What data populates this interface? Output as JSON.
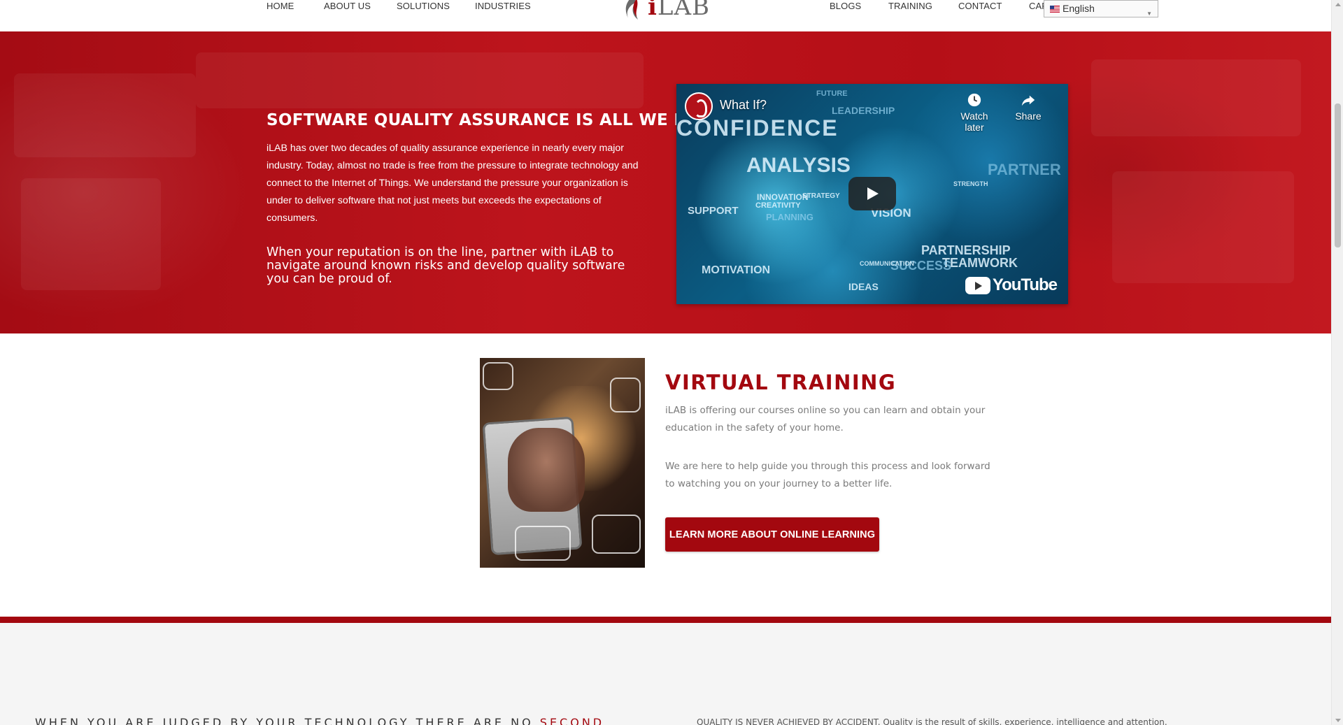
{
  "nav": {
    "left_items": [
      "HOME",
      "ABOUT US",
      "SOLUTIONS",
      "INDUSTRIES"
    ],
    "right_items": [
      "BLOGS",
      "TRAINING",
      "CONTACT",
      "CAR"
    ],
    "logo_text": "iLAB",
    "language": {
      "selected": "English",
      "flag_icon": "us-flag-icon"
    }
  },
  "hero": {
    "title": "SOFTWARE QUALITY ASSURANCE IS ALL WE DO.",
    "body": "iLAB has over two decades of quality assurance experience in nearly every major industry. Today, almost no trade is free from the pressure to integrate technology and connect to the Internet of Things. We understand the pressure your organization is under to deliver software that not just meets but exceeds the expectations of consumers.",
    "subtext": "When your reputation is on the line, partner with iLAB to navigate around known risks and develop quality software you can be proud of.",
    "colors": {
      "hero_red": "#b60f18",
      "brand_red": "#a3080f"
    }
  },
  "video": {
    "title": "What If?",
    "watch_later": "Watch later",
    "share": "Share",
    "youtube": "YouTube",
    "words": [
      "CONFIDENCE",
      "ANALYSIS",
      "VISION",
      "SUPPORT",
      "INNOVATION",
      "CREATIVITY",
      "PLANNING",
      "MOTIVATION",
      "PARTNERSHIP",
      "TEAMWORK",
      "LEADERSHIP",
      "SUCCESS",
      "PARTNER",
      "FUTURE",
      "IDEAS",
      "COMMUNICATION",
      "STRENGTH",
      "STRATEGY"
    ]
  },
  "training": {
    "title": "VIRTUAL TRAINING",
    "paragraph1": "iLAB is offering our courses online so you can learn and obtain your education in the safety of your home.",
    "paragraph2": "We are here to help guide you through this process and look forward to watching you on your journey to a better life.",
    "button_label": "LEARN MORE ABOUT ONLINE LEARNING"
  },
  "bottom": {
    "left_text": "WHEN YOU ARE JUDGED BY YOUR TECHNOLOGY THERE ARE NO",
    "left_accent": "SECOND",
    "right_text": "QUALITY IS NEVER ACHIEVED BY ACCIDENT. Quality is the result of skills, experience, intelligence and attention."
  }
}
